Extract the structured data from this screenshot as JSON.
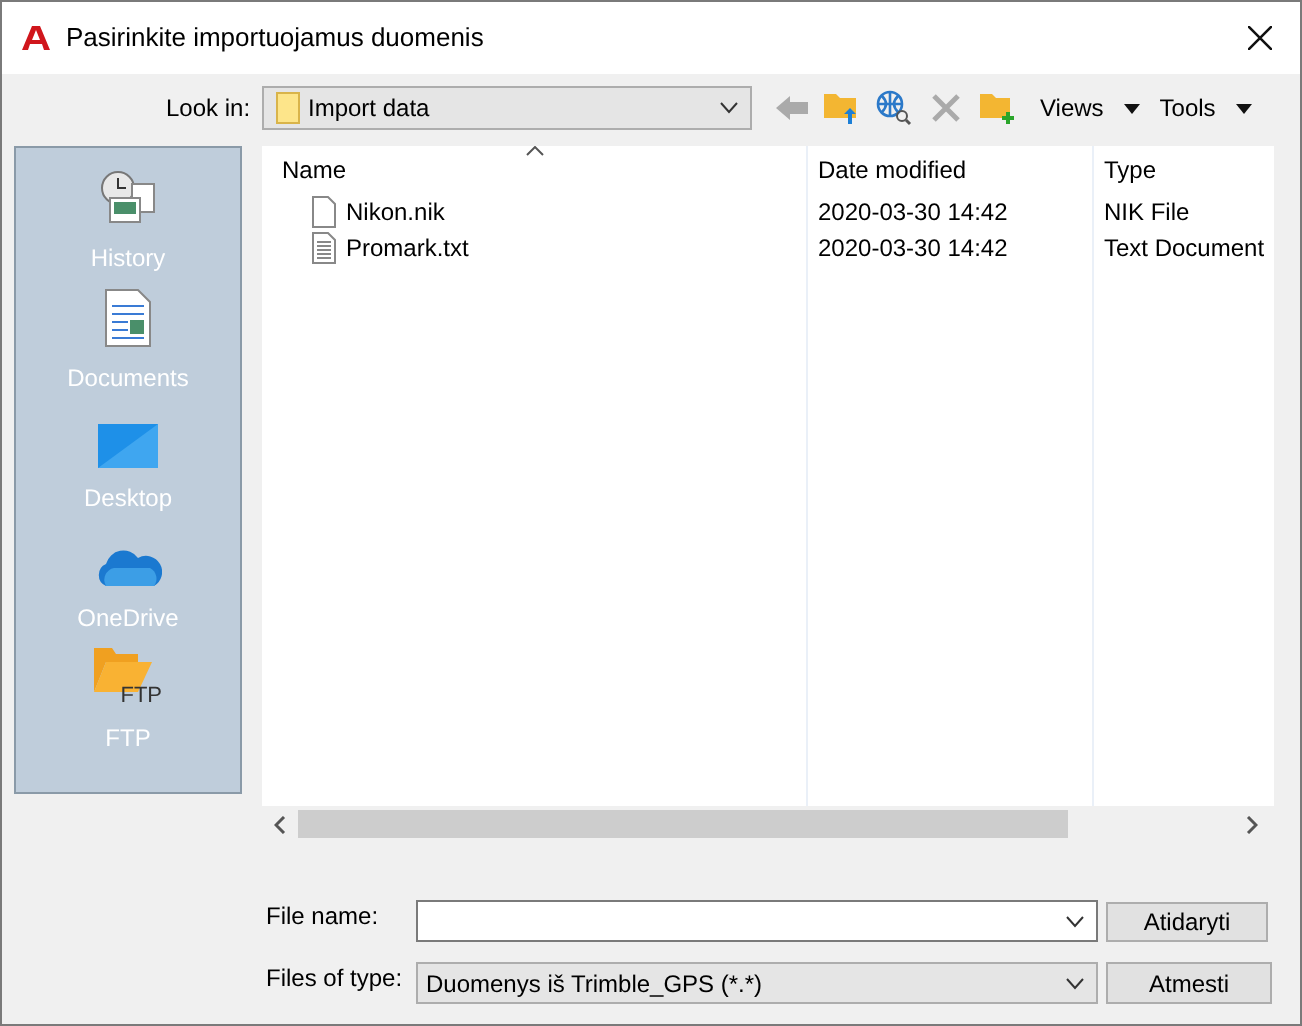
{
  "window": {
    "title": "Pasirinkite importuojamus duomenis"
  },
  "toolbar": {
    "look_in_label": "Look in:",
    "look_in_value": "Import data",
    "views": "Views",
    "tools": "Tools"
  },
  "sidebar": {
    "items": [
      {
        "kind": "history",
        "label": "History"
      },
      {
        "kind": "documents",
        "label": "Documents"
      },
      {
        "kind": "desktop",
        "label": "Desktop"
      },
      {
        "kind": "onedrive",
        "label": "OneDrive"
      },
      {
        "kind": "ftp",
        "label": "FTP",
        "icon_text": "FTP"
      }
    ]
  },
  "file_list": {
    "columns": [
      "Name",
      "Date modified",
      "Type"
    ],
    "rows": [
      {
        "kind": "plain",
        "name": "Nikon.nik",
        "date": "2020-03-30 14:42",
        "type": "NIK File"
      },
      {
        "kind": "text",
        "name": "Promark.txt",
        "date": "2020-03-30 14:42",
        "type": "Text Document"
      }
    ]
  },
  "file_name": {
    "label": "File name:"
  },
  "file_type": {
    "label": "Files of type:",
    "value": "Duomenys iš Trimble_GPS (*.*)"
  },
  "buttons": [
    "Atidaryti",
    "Atmesti"
  ]
}
